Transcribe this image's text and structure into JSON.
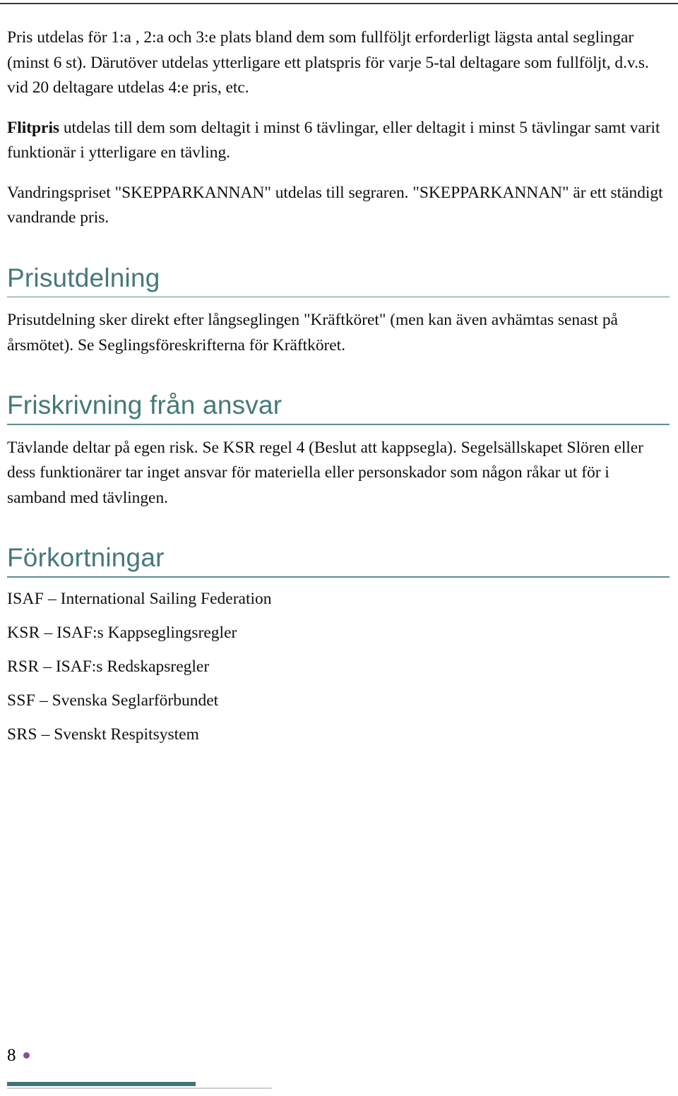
{
  "document": {
    "page_number": "8",
    "accent_color": "#46787b",
    "rule_color": "#5e8e90",
    "footer_bar_color": "#3f7577",
    "page_dot_color": "#8e4b9e"
  },
  "body": {
    "paragraph_1": "Pris utdelas för 1:a , 2:a och 3:e plats bland dem som fullföljt erforderligt lägsta antal seglingar (minst 6 st). Därutöver utdelas ytterligare ett platspris för varje 5-tal deltagare som fullföljt, d.v.s. vid 20 deltagare utdelas 4:e pris, etc.",
    "paragraph_2_bold_lead": "Flitpris",
    "paragraph_2_rest": " utdelas till dem som deltagit i minst 6 tävlingar, eller deltagit i minst 5 tävlingar samt varit funktionär i ytterligare en tävling.",
    "paragraph_3": "Vandringspriset \"SKEPPARKANNAN\" utdelas till segraren. \"SKEPPARKANNAN\" är ett ständigt vandrande pris."
  },
  "sections": {
    "prisutdelning": {
      "heading": "Prisutdelning",
      "paragraph": "Prisutdelning sker direkt efter långseglingen \"Kräftköret\" (men kan även avhämtas senast på årsmötet). Se Seglingsföreskrifterna för Kräftköret."
    },
    "friskrivning": {
      "heading": "Friskrivning från ansvar",
      "paragraph": "Tävlande deltar på egen risk. Se KSR regel 4 (Beslut att kappsegla). Segelsällskapet Slören eller dess funktionärer tar inget ansvar för materiella eller personskador som någon råkar ut för i samband med tävlingen."
    },
    "forkortningar": {
      "heading": "Förkortningar",
      "items": [
        {
          "term": "ISAF",
          "separator": " – ",
          "definition": "International Sailing Federation"
        },
        {
          "term": "KSR",
          "separator": " – ",
          "definition": "ISAF:s Kappseglingsregler"
        },
        {
          "term": "RSR",
          "separator": " – ",
          "definition": "ISAF:s Redskapsregler"
        },
        {
          "term": "SSF",
          "separator": " – ",
          "definition": "Svenska Seglarförbundet"
        },
        {
          "term": "SRS",
          "separator": " – ",
          "definition": "Svenskt Respitsystem"
        }
      ]
    }
  }
}
